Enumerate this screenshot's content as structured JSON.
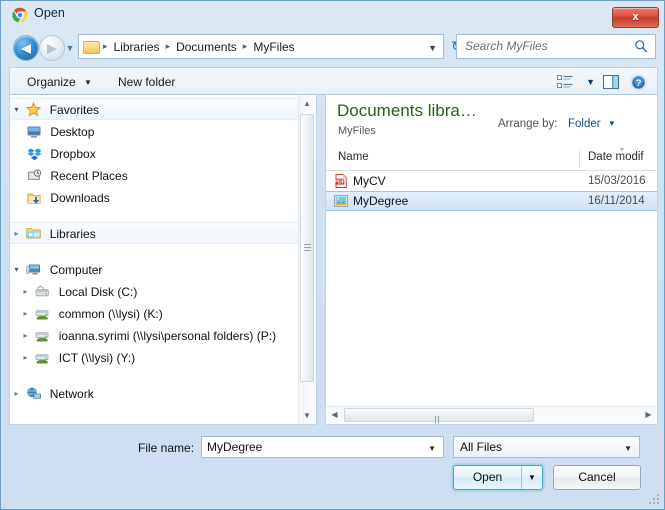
{
  "window": {
    "title": "Open",
    "title_icon": "chrome-logo-icon",
    "close_label": "x"
  },
  "navigation": {
    "back_icon": "back-arrow-icon",
    "back_glyph": "◀",
    "forward_icon": "forward-arrow-icon",
    "forward_glyph": "▶",
    "history_glyph": "▼",
    "refresh_glyph": "↻",
    "breadcrumb_separator": "▸",
    "breadcrumb": [
      "Libraries",
      "Documents",
      "MyFiles"
    ],
    "breadcrumb_dropdown_glyph": "▼"
  },
  "search": {
    "placeholder": "Search MyFiles",
    "icon": "search-magnifier-icon"
  },
  "commandbar": {
    "organize_label": "Organize",
    "new_folder_label": "New folder",
    "caret_glyph": "▼",
    "view_icon": "view-mode-icon",
    "view_caret_glyph": "▼",
    "preview_icon": "preview-pane-icon",
    "help_icon": "help-question-icon",
    "help_glyph": "?"
  },
  "sidebar": {
    "groups": [
      {
        "label": "Favorites",
        "icon": "star-icon",
        "expander": "▾",
        "expanded": true,
        "items": [
          {
            "label": "Desktop",
            "icon": "desktop-icon"
          },
          {
            "label": "Dropbox",
            "icon": "dropbox-icon"
          },
          {
            "label": "Recent Places",
            "icon": "recent-places-icon"
          },
          {
            "label": "Downloads",
            "icon": "downloads-icon"
          }
        ]
      },
      {
        "label": "Libraries",
        "icon": "libraries-folder-icon",
        "expander": "▸",
        "expanded": false,
        "items": []
      },
      {
        "label": "Computer",
        "icon": "computer-icon",
        "expander": "▾",
        "expanded": true,
        "items": [
          {
            "label": "Local Disk (C:)",
            "icon": "hard-disk-icon",
            "expander": "▸"
          },
          {
            "label": "common (\\\\lysi) (K:)",
            "icon": "network-drive-icon",
            "expander": "▸"
          },
          {
            "label": "ioanna.syrimi (\\\\lysi\\personal folders) (P:)",
            "icon": "network-drive-icon",
            "expander": "▸"
          },
          {
            "label": "ICT (\\\\lysi) (Y:)",
            "icon": "network-drive-icon",
            "expander": "▸"
          }
        ]
      },
      {
        "label": "Network",
        "icon": "network-icon",
        "expander": "▸",
        "expanded": false,
        "items": []
      }
    ],
    "scrollbar": {
      "up_glyph": "▲",
      "down_glyph": "▼"
    }
  },
  "library": {
    "heading": "Documents libra…",
    "subheading": "MyFiles",
    "arrange_label": "Arrange by:",
    "arrange_value": "Folder",
    "arrange_caret_glyph": "▼"
  },
  "filelist": {
    "columns": [
      "Name",
      "Date modif"
    ],
    "sort_glyph": "▾",
    "rows": [
      {
        "name": "MyCV",
        "date": "15/03/2016",
        "icon": "pdf-file-icon",
        "selected": false
      },
      {
        "name": "MyDegree",
        "date": "16/11/2014",
        "icon": "image-file-icon",
        "selected": true
      }
    ],
    "hscroll": {
      "left_glyph": "◀",
      "right_glyph": "▶"
    }
  },
  "footer": {
    "filename_label": "File name:",
    "filename_value": "MyDegree",
    "filename_caret_glyph": "▼",
    "filter_value": "All Files",
    "filter_caret_glyph": "▼",
    "open_label": "Open",
    "open_split_glyph": "▼",
    "cancel_label": "Cancel"
  },
  "colors": {
    "accent": "#2f86cd",
    "library_heading": "#2c5d1e",
    "link_blue": "#12538f",
    "selection": "#cfe2f6",
    "close_red": "#c6392a"
  }
}
